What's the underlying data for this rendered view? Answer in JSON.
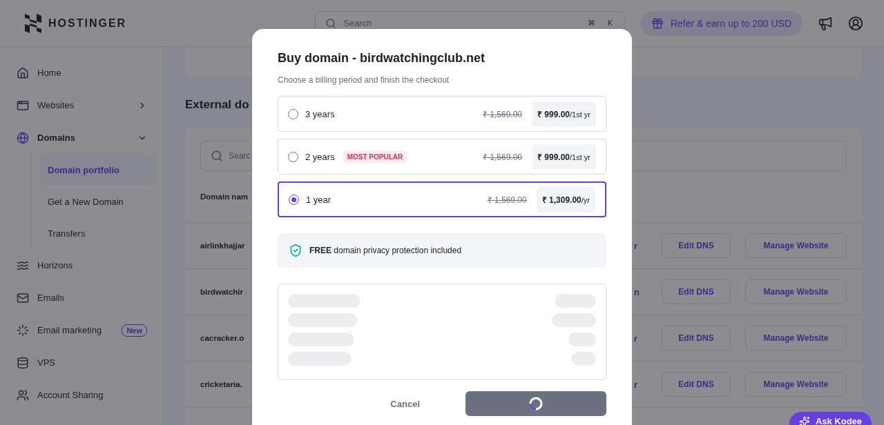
{
  "header": {
    "logo": "HOSTINGER",
    "search": {
      "placeholder": "Search",
      "shortcut": [
        "⌘",
        "K"
      ]
    },
    "refer": "Refer & earn up to 200 USD"
  },
  "sidebar": {
    "items": [
      {
        "label": "Home",
        "kind": "link",
        "selected": false
      },
      {
        "label": "Websites",
        "kind": "group",
        "selected": false,
        "expanded": false
      },
      {
        "label": "Domains",
        "kind": "group",
        "selected": true,
        "expanded": true,
        "children": [
          {
            "label": "Domain portfolio",
            "selected": true
          },
          {
            "label": "Get a New Domain",
            "selected": false
          },
          {
            "label": "Transfers",
            "selected": false
          }
        ]
      },
      {
        "label": "Horizons",
        "kind": "link",
        "selected": false
      },
      {
        "label": "Emails",
        "kind": "link",
        "selected": false
      },
      {
        "label": "Email marketing",
        "kind": "link",
        "selected": false,
        "badge": "New"
      },
      {
        "label": "VPS",
        "kind": "link",
        "selected": false
      },
      {
        "label": "Account Sharing",
        "kind": "link",
        "selected": false
      }
    ]
  },
  "main": {
    "heading": "External do",
    "search": {
      "placeholder": "Searc"
    },
    "table": {
      "columns": [
        "Domain nam"
      ],
      "rows": [
        {
          "domain": "airlinkhajjar",
          "column_2": "r",
          "actions": [
            "Edit DNS",
            "Manage Website"
          ]
        },
        {
          "domain": "birdwatchir",
          "column_2": "n",
          "actions": [
            "Edit DNS",
            "Manage Website"
          ]
        },
        {
          "domain": "cacracker.o",
          "column_2": "r",
          "actions": [
            "Edit DNS",
            "Manage Website"
          ]
        },
        {
          "domain": "cricketaria.",
          "column_2": "r",
          "actions": [
            "Edit DNS",
            "Manage Website"
          ]
        }
      ]
    }
  },
  "modal": {
    "title": "Buy domain - birdwatchingclub.net",
    "subtitle": "Choose a billing period and finish the checkout",
    "options": [
      {
        "label": "3 years",
        "old_price": "₹ 1,569.00",
        "price": "₹ 999.00",
        "period": "/1st yr",
        "selected": false
      },
      {
        "label": "2 years",
        "badge": "MOST POPULAR",
        "old_price": "₹ 1,569.00",
        "price": "₹ 999.00",
        "period": "/1st yr",
        "selected": false
      },
      {
        "label": "1 year",
        "old_price": "₹ 1,569.00",
        "price": "₹ 1,309.00",
        "period": "/yr",
        "selected": true
      }
    ],
    "privacy": "**FREE** domain privacy protection included",
    "summary": {
      "loading": true
    },
    "cancel": "Cancel",
    "submit": {
      "loading": true
    }
  },
  "assistant": {
    "label": "Ask Kodee"
  }
}
